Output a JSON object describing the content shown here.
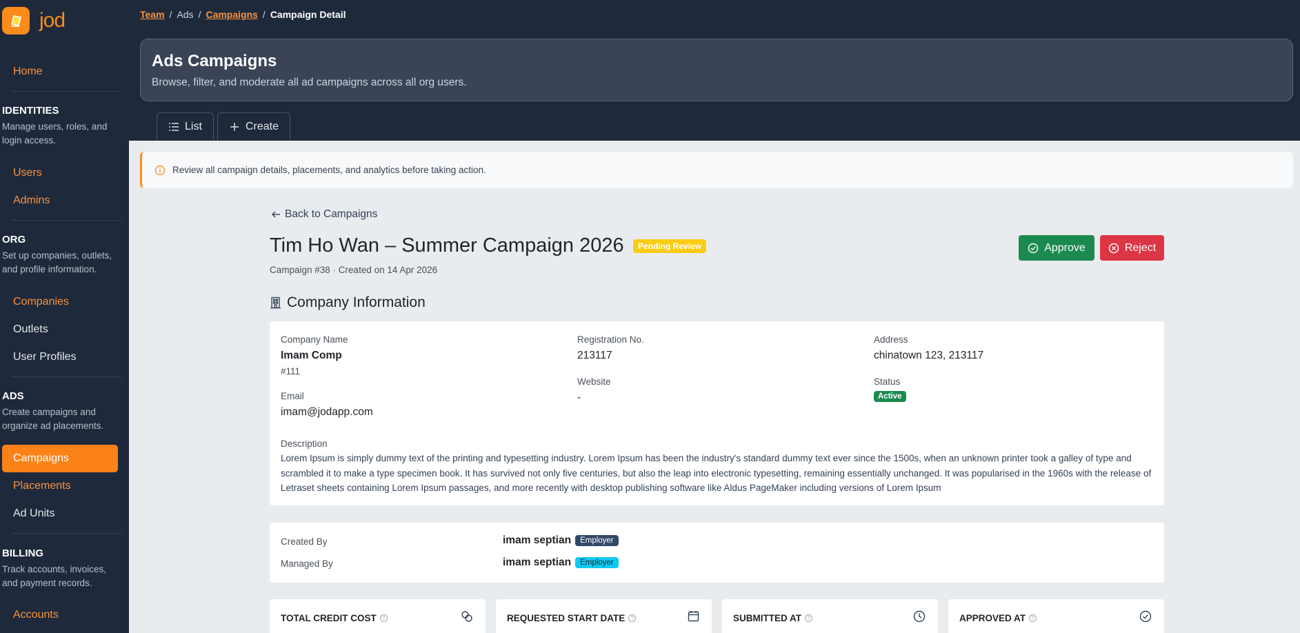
{
  "app": {
    "logo_text": "jod"
  },
  "sidebar": {
    "home": "Home",
    "identities": {
      "title": "IDENTITIES",
      "desc": "Manage users, roles, and login access.",
      "items": [
        "Users",
        "Admins"
      ]
    },
    "org": {
      "title": "ORG",
      "desc": "Set up companies, outlets, and profile information.",
      "items": [
        "Companies",
        "Outlets",
        "User Profiles"
      ]
    },
    "ads": {
      "title": "ADS",
      "desc": "Create campaigns and organize ad placements.",
      "items": [
        "Campaigns",
        "Placements",
        "Ad Units"
      ]
    },
    "billing": {
      "title": "BILLING",
      "desc": "Track accounts, invoices, and payment records.",
      "items": [
        "Accounts"
      ]
    }
  },
  "breadcrumb": {
    "team": "Team",
    "ads": "Ads",
    "campaigns": "Campaigns",
    "current": "Campaign Detail"
  },
  "hero": {
    "title": "Ads Campaigns",
    "subtitle": "Browse, filter, and moderate all ad campaigns across all org users."
  },
  "tabs": {
    "list": "List",
    "create": "Create"
  },
  "alert": {
    "text": "Review all campaign details, placements, and analytics before taking action."
  },
  "campaign": {
    "back": "Back to Campaigns",
    "title": "Tim Ho Wan – Summer Campaign 2026",
    "status": "Pending Review",
    "meta": "Campaign #38 · Created on 14 Apr 2026",
    "approve": "Approve",
    "reject": "Reject"
  },
  "company": {
    "section_title": "Company Information",
    "name_label": "Company Name",
    "name": "Imam Comp",
    "id": "#111",
    "email_label": "Email",
    "email": "imam@jodapp.com",
    "reg_label": "Registration No.",
    "reg": "213117",
    "website_label": "Website",
    "website": "-",
    "address_label": "Address",
    "address": "chinatown 123, 213117",
    "status_label": "Status",
    "status": "Active",
    "desc_label": "Description",
    "desc": "Lorem Ipsum is simply dummy text of the printing and typesetting industry. Lorem Ipsum has been the industry's standard dummy text ever since the 1500s, when an unknown printer took a galley of type and scrambled it to make a type specimen book. It has survived not only five centuries, but also the leap into electronic typesetting, remaining essentially unchanged. It was popularised in the 1960s with the release of Letraset sheets containing Lorem Ipsum passages, and more recently with desktop publishing software like Aldus PageMaker including versions of Lorem Ipsum"
  },
  "people": {
    "created_label": "Created By",
    "created_name": "imam septian",
    "created_role": "Employer",
    "managed_label": "Managed By",
    "managed_name": "imam septian",
    "managed_role": "Employer"
  },
  "stats": [
    {
      "title": "TOTAL CREDIT COST",
      "icon": "coins-icon"
    },
    {
      "title": "REQUESTED START DATE",
      "icon": "calendar-icon"
    },
    {
      "title": "SUBMITTED AT",
      "icon": "clock-icon"
    },
    {
      "title": "APPROVED AT",
      "icon": "check-circle-icon"
    }
  ],
  "colors": {
    "accent": "#fb8c1a",
    "sidebar": "#1e293b",
    "approve": "#1c8a4f",
    "reject": "#dc3545",
    "pending": "#facc15"
  }
}
